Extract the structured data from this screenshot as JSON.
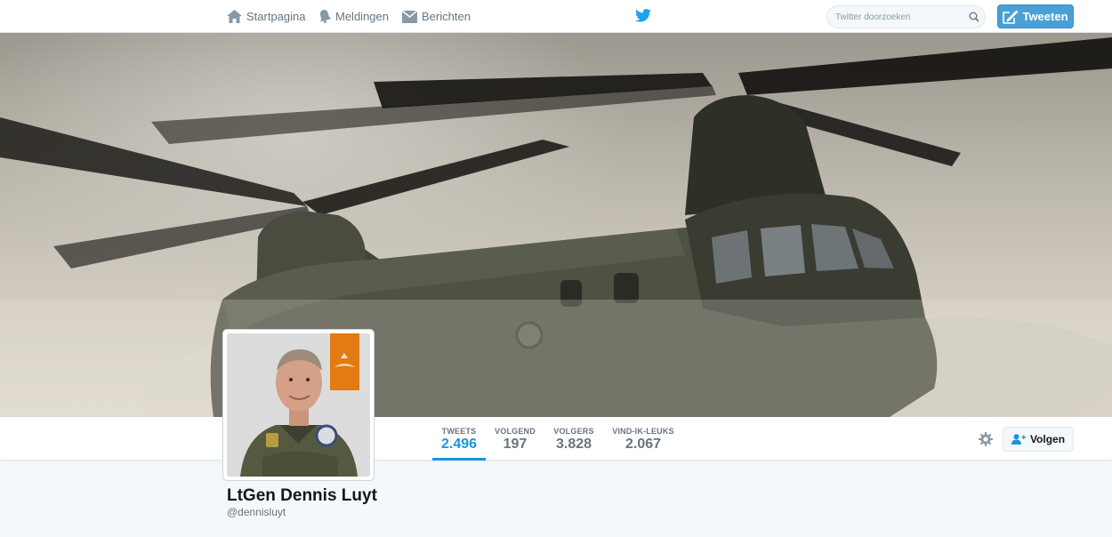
{
  "nav": {
    "home_label": "Startpagina",
    "notifications_label": "Meldingen",
    "messages_label": "Berichten"
  },
  "search": {
    "placeholder": "Twitter doorzoeken"
  },
  "compose": {
    "label": "Tweeten"
  },
  "profile": {
    "name": "LtGen Dennis Luyt",
    "handle": "@dennisluyt"
  },
  "stats": [
    {
      "label": "TWEETS",
      "value": "2.496",
      "active": true
    },
    {
      "label": "VOLGEND",
      "value": "197",
      "active": false
    },
    {
      "label": "VOLGERS",
      "value": "3.828",
      "active": false
    },
    {
      "label": "VIND-IK-LEUKS",
      "value": "2.067",
      "active": false
    }
  ],
  "follow": {
    "label": "Volgen"
  },
  "colors": {
    "accent": "#1b95e0",
    "tweet_button": "#4aa0d5",
    "text_muted": "#66757f",
    "text_dark": "#14171a"
  },
  "icons": {
    "home": "home-icon",
    "notifications": "bell-icon",
    "messages": "envelope-icon",
    "brand": "twitter-bird-icon",
    "search": "search-icon",
    "compose": "compose-icon",
    "settings": "gear-icon",
    "follow": "add-user-icon"
  }
}
